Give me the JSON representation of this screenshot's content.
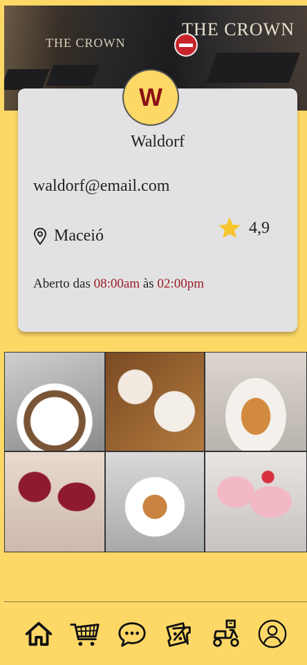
{
  "cover": {
    "sign_main": "THE CROWN",
    "sign_left": "THE CROWN"
  },
  "profile": {
    "avatar_letter": "W",
    "name": "Waldorf",
    "email": "waldorf@email.com",
    "city": "Maceió",
    "rating": "4,9",
    "hours": {
      "prefix": "Aberto das",
      "open": "08:00am",
      "sep": "às",
      "close": "02:00pm"
    }
  },
  "gallery": [
    {
      "icon": "coffee-cup-photo"
    },
    {
      "icon": "cake-slices-photo"
    },
    {
      "icon": "croissant-photo"
    },
    {
      "icon": "cocktails-photo"
    },
    {
      "icon": "pancakes-photo"
    },
    {
      "icon": "milkshakes-photo"
    }
  ],
  "nav": [
    {
      "icon": "home-icon"
    },
    {
      "icon": "cart-icon"
    },
    {
      "icon": "chat-icon"
    },
    {
      "icon": "coupon-icon"
    },
    {
      "icon": "delivery-scooter-icon"
    },
    {
      "icon": "profile-icon"
    }
  ],
  "colors": {
    "background": "#FDD866",
    "card": "#E2E2E4",
    "accent": "#9B1B22",
    "star": "#F7C52B"
  }
}
